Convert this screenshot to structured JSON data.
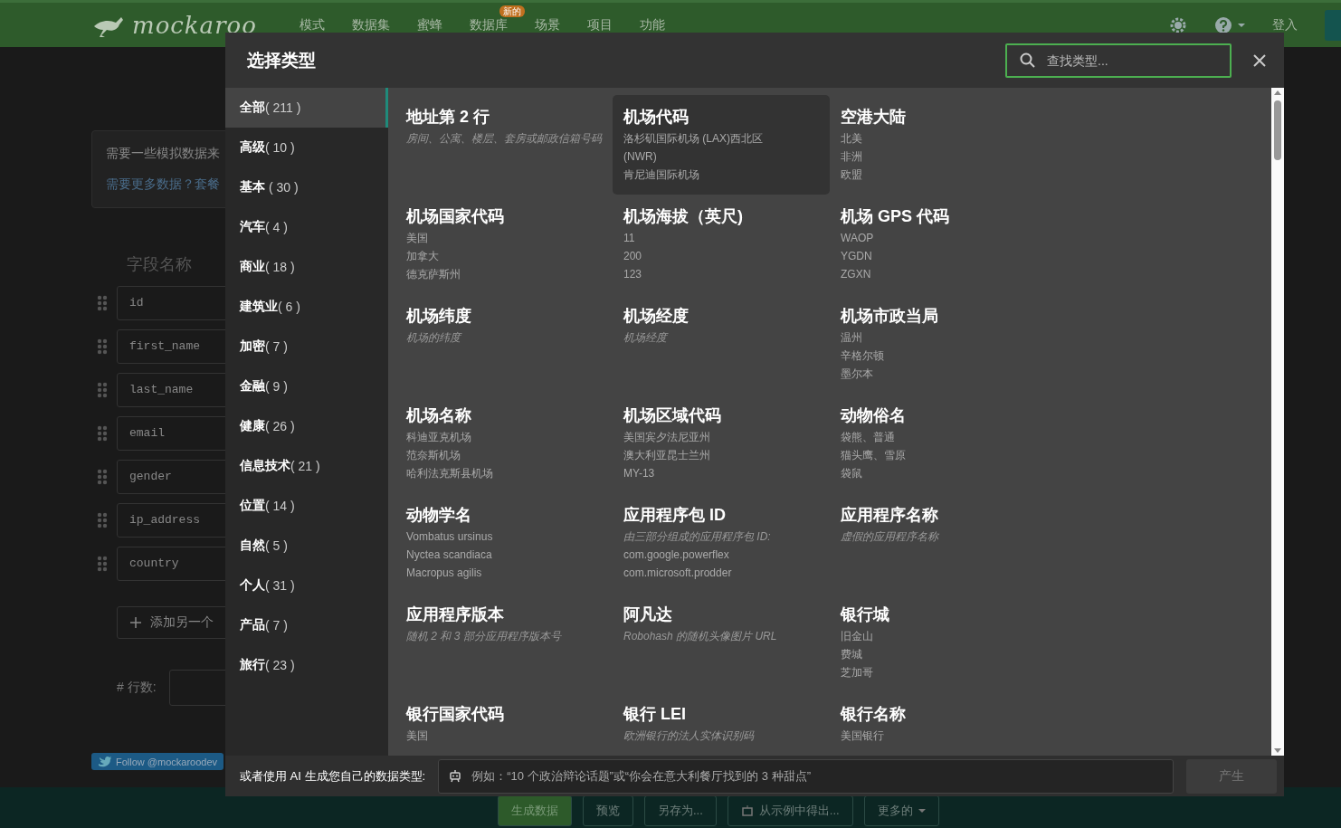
{
  "nav": {
    "logo": "mockaroo",
    "menu": [
      {
        "label": "模式"
      },
      {
        "label": "数据集"
      },
      {
        "label": "蜜蜂"
      },
      {
        "label": "数据库",
        "badge": "新的"
      },
      {
        "label": "场景"
      },
      {
        "label": "项目"
      },
      {
        "label": "功能"
      }
    ],
    "login": "登入"
  },
  "background": {
    "notice": [
      "需要一些模拟数据来",
      "需要更多数据？套餐"
    ],
    "field_heading": "字段名称",
    "fields": [
      "id",
      "first_name",
      "last_name",
      "email",
      "gender",
      "ip_address",
      "country"
    ],
    "add_field": "添加另一个",
    "rows_label": "# 行数:",
    "follow": "Follow @mockaroodev",
    "actions": [
      "生成数据",
      "预览",
      "另存为...",
      "从示例中得出...",
      "更多的"
    ]
  },
  "dialog": {
    "title": "选择类型",
    "search": {
      "placeholder": "查找类型..."
    },
    "categories": [
      {
        "name": "全部",
        "count": "( 211 )",
        "selected": true
      },
      {
        "name": "高级",
        "count": "( 10 )",
        "selected": false
      },
      {
        "name": "基本",
        "count": " ( 30 )",
        "selected": false
      },
      {
        "name": "汽车",
        "count": "( 4 )",
        "selected": false
      },
      {
        "name": "商业",
        "count": "( 18 )",
        "selected": false
      },
      {
        "name": "建筑业",
        "count": "( 6 )",
        "selected": false
      },
      {
        "name": "加密",
        "count": "( 7 )",
        "selected": false
      },
      {
        "name": "金融",
        "count": "( 9 )",
        "selected": false
      },
      {
        "name": "健康",
        "count": "( 26 )",
        "selected": false
      },
      {
        "name": "信息技术",
        "count": "( 21 )",
        "selected": false
      },
      {
        "name": "位置",
        "count": "( 14 )",
        "selected": false
      },
      {
        "name": "自然",
        "count": "( 5 )",
        "selected": false
      },
      {
        "name": "个人",
        "count": "( 31 )",
        "selected": false
      },
      {
        "name": "产品",
        "count": "( 7 )",
        "selected": false
      },
      {
        "name": "旅行",
        "count": "( 23 )",
        "selected": false
      }
    ],
    "types": [
      {
        "title": "地址第 2 行",
        "highlighted": false,
        "description": "房间、公寓、楼层、套房或邮政信箱号码"
      },
      {
        "title": "机场代码",
        "highlighted": true,
        "examples": [
          "洛杉矶国际机场 (LAX)西北区",
          "(NWR)",
          "肯尼迪国际机场"
        ]
      },
      {
        "title": "空港大陆",
        "highlighted": false,
        "examples": [
          "北美",
          "非洲",
          "欧盟"
        ]
      },
      {
        "title": "机场国家代码",
        "highlighted": false,
        "examples": [
          "美国",
          "加拿大",
          "德克萨斯州"
        ]
      },
      {
        "title": "机场海拔（英尺)",
        "highlighted": false,
        "examples": [
          "11",
          "200",
          "123"
        ]
      },
      {
        "title": "机场 GPS 代码",
        "highlighted": false,
        "examples": [
          "WAOP",
          "YGDN",
          "ZGXN"
        ]
      },
      {
        "title": "机场纬度",
        "highlighted": false,
        "description": "机场的纬度"
      },
      {
        "title": "机场经度",
        "highlighted": false,
        "description": "机场经度"
      },
      {
        "title": "机场市政当局",
        "highlighted": false,
        "examples": [
          "温州",
          "辛格尔顿",
          "墨尔本"
        ]
      },
      {
        "title": "机场名称",
        "highlighted": false,
        "examples": [
          "科迪亚克机场",
          "范奈斯机场",
          "哈利法克斯县机场"
        ]
      },
      {
        "title": "机场区域代码",
        "highlighted": false,
        "examples": [
          "美国宾夕法尼亚州",
          "澳大利亚昆士兰州",
          "MY-13"
        ]
      },
      {
        "title": "动物俗名",
        "highlighted": false,
        "examples": [
          "袋熊、普通",
          "猫头鹰、雪原",
          "袋鼠"
        ]
      },
      {
        "title": "动物学名",
        "highlighted": false,
        "examples": [
          "Vombatus ursinus",
          "Nyctea scandiaca",
          "Macropus agilis"
        ]
      },
      {
        "title": "应用程序包 ID",
        "highlighted": false,
        "description": "由三部分组成的应用程序包 ID:",
        "examples": [
          "com.google.powerflex",
          "com.microsoft.prodder"
        ]
      },
      {
        "title": "应用程序名称",
        "highlighted": false,
        "description": "虚假的应用程序名称"
      },
      {
        "title": "应用程序版本",
        "highlighted": false,
        "description": "随机 2 和 3 部分应用程序版本号"
      },
      {
        "title": "阿凡达",
        "highlighted": false,
        "description": "Robohash 的随机头像图片 URL"
      },
      {
        "title": "银行城",
        "highlighted": false,
        "examples": [
          "旧金山",
          "费城",
          "芝加哥"
        ]
      },
      {
        "title": "银行国家代码",
        "highlighted": false,
        "examples": [
          "美国"
        ]
      },
      {
        "title": "银行 LEI",
        "highlighted": false,
        "description": "欧洲银行的法人实体识别码"
      },
      {
        "title": "银行名称",
        "highlighted": false,
        "examples": [
          "美国银行"
        ]
      }
    ],
    "ai": {
      "label": "或者使用 AI 生成您自己的数据类型:",
      "placeholder": "例如：“10 个政治辩论话题”或“你会在意大利餐厅找到的 3 种甜点”",
      "button": "产生",
      "button_disabled": true
    }
  }
}
